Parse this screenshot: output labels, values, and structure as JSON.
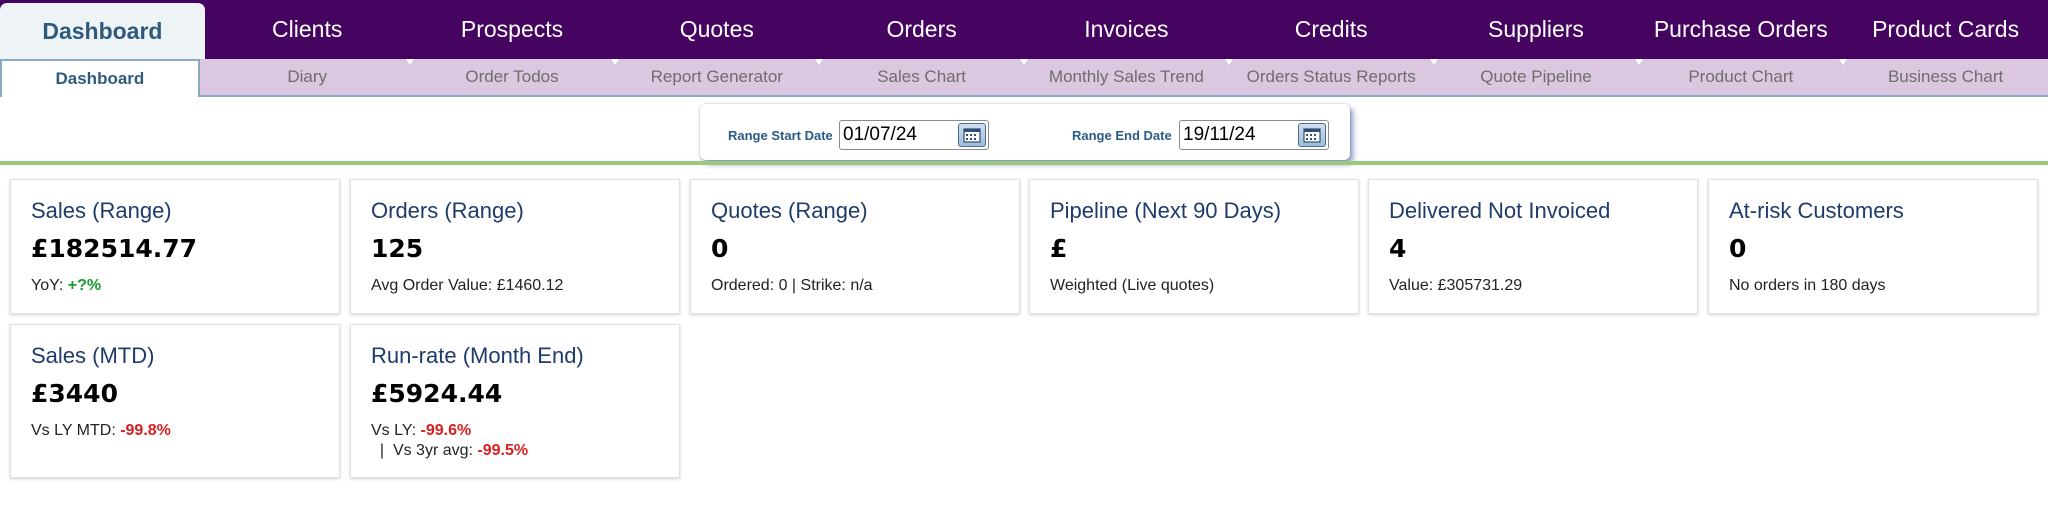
{
  "nav": {
    "tabs": [
      {
        "label": "Dashboard"
      },
      {
        "label": "Clients"
      },
      {
        "label": "Prospects"
      },
      {
        "label": "Quotes"
      },
      {
        "label": "Orders"
      },
      {
        "label": "Invoices"
      },
      {
        "label": "Credits"
      },
      {
        "label": "Suppliers"
      },
      {
        "label": "Purchase Orders"
      },
      {
        "label": "Product Cards"
      }
    ],
    "subtabs": [
      {
        "label": "Dashboard"
      },
      {
        "label": "Diary"
      },
      {
        "label": "Order Todos"
      },
      {
        "label": "Report Generator"
      },
      {
        "label": "Sales Chart"
      },
      {
        "label": "Monthly Sales Trend"
      },
      {
        "label": "Orders Status Reports"
      },
      {
        "label": "Quote Pipeline"
      },
      {
        "label": "Product Chart"
      },
      {
        "label": "Business Chart"
      }
    ]
  },
  "range": {
    "start_label": "Range Start Date",
    "start_value": "01/07/24",
    "end_label": "Range End Date",
    "end_value": "19/11/24"
  },
  "cards": [
    {
      "title": "Sales (Range)",
      "value": "£182514.77",
      "sub_prefix": "YoY: ",
      "sub_highlight": "+?%"
    },
    {
      "title": "Orders (Range)",
      "value": "125",
      "sub": "Avg Order Value: £1460.12"
    },
    {
      "title": "Quotes (Range)",
      "value": "0",
      "sub": "Ordered: 0 | Strike: n/a"
    },
    {
      "title": "Pipeline (Next 90 Days)",
      "value": "£",
      "sub": "Weighted (Live quotes)"
    },
    {
      "title": "Delivered Not Invoiced",
      "value": "4",
      "sub": "Value: £305731.29"
    },
    {
      "title": "At-risk Customers",
      "value": "0",
      "sub": "No orders in 180 days"
    },
    {
      "title": "Sales (MTD)",
      "value": "£3440",
      "sub_prefix": "Vs LY MTD: ",
      "sub_highlight": "-99.8%"
    },
    {
      "title": "Run-rate (Month End)",
      "value": "£5924.44",
      "sub_prefix": "Vs LY: ",
      "sub_highlight": "-99.6%",
      "sub_mid": "  |  Vs 3yr avg: ",
      "sub_highlight2": "-99.5%"
    }
  ],
  "colors": {
    "nav_bg": "#44045f",
    "subnav_bg": "#dcc7e0",
    "positive": "#1a9a2c",
    "negative": "#d81f1f",
    "card_title": "#1f3b6b"
  }
}
